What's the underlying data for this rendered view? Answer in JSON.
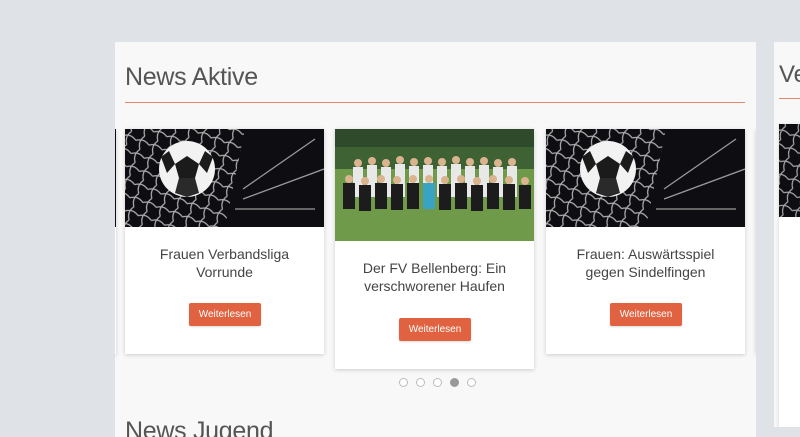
{
  "sections": {
    "news_aktive": {
      "title": "News Aktive"
    },
    "news_jugend": {
      "title": "News Jugend"
    },
    "right_section": {
      "title_fragment": "Ve"
    }
  },
  "carousel": {
    "cards": [
      {
        "title": "Frauen Verbandsliga Vorrunde",
        "image": "soccer-ball-in-net-image",
        "button_label": "Weiterlesen"
      },
      {
        "title": "Der FV Bellenberg: Ein verschworener Haufen",
        "image": "team-group-photo-image",
        "button_label": "Weiterlesen"
      },
      {
        "title": "Frauen: Auswärtsspiel gegen Sindelfingen",
        "image": "soccer-ball-in-net-image",
        "button_label": "Weiterlesen"
      }
    ],
    "dots": {
      "count": 5,
      "active_index": 3
    }
  },
  "colors": {
    "accent": "#e06241",
    "page_background": "#dfe2e7",
    "panel_background": "#f8f8f8",
    "title_rule": "#e2876a"
  }
}
